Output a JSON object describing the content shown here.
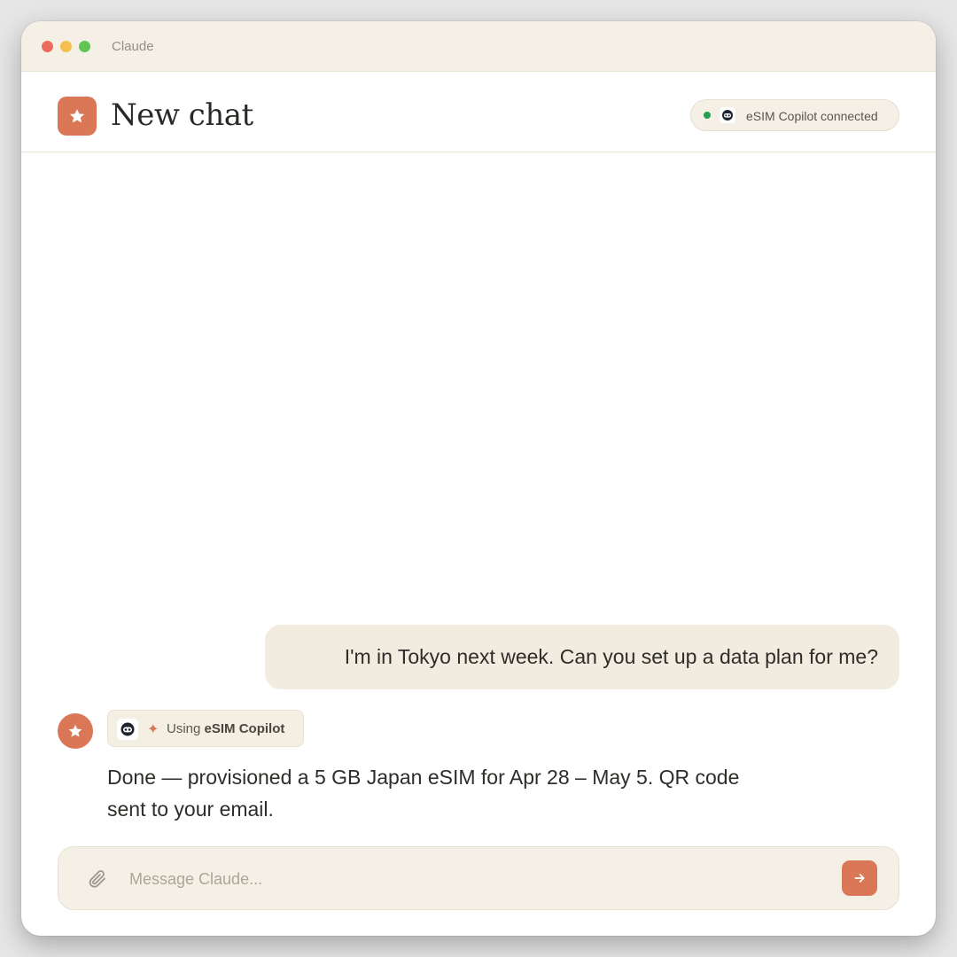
{
  "window": {
    "app_title": "Claude"
  },
  "header": {
    "chat_title": "New chat",
    "connector": {
      "label": "eSIM Copilot connected",
      "status": "connected",
      "status_color": "#22a04f"
    }
  },
  "messages": {
    "user": {
      "text": "I'm in Tokyo next week. Can you set up a data plan for me?"
    },
    "assistant": {
      "tool_use": {
        "prefix": "Using",
        "tool_name": "eSIM Copilot"
      },
      "text": "Done — provisioned a 5 GB Japan eSIM for Apr 28 – May 5. QR code sent to your email."
    }
  },
  "composer": {
    "placeholder": "Message Claude...",
    "value": ""
  },
  "icons": {
    "logo": "star-icon",
    "connector": "robot-icon",
    "tool": "sparkle-icon",
    "attach": "paperclip-icon",
    "send": "arrow-right-icon"
  },
  "colors": {
    "accent": "#d97757",
    "titlebar_bg": "#f5f0e6",
    "bubble_bg": "#f1ecdf",
    "status_green": "#22a04f"
  }
}
